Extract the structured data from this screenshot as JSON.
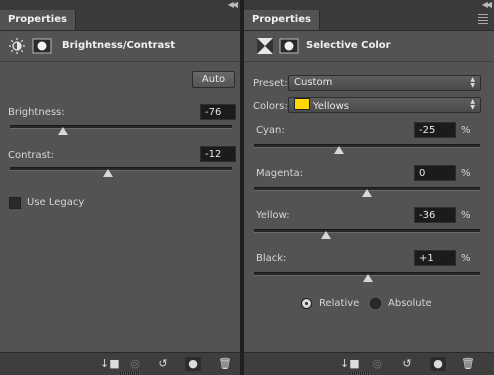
{
  "left": {
    "tab_label": "Properties",
    "title": "Brightness/Contrast",
    "auto_label": "Auto",
    "brightness": {
      "label": "Brightness:",
      "value": "-76",
      "slider": 0.24
    },
    "contrast": {
      "label": "Contrast:",
      "value": "-12",
      "slider": 0.44
    },
    "use_legacy_label": "Use Legacy",
    "use_legacy_checked": false
  },
  "right": {
    "tab_label": "Properties",
    "title": "Selective Color",
    "preset": {
      "label": "Preset:",
      "value": "Custom"
    },
    "colors": {
      "label": "Colors:",
      "value": "Yellows",
      "swatch": "#ffd800"
    },
    "cyan": {
      "label": "Cyan:",
      "value": "-25",
      "unit": "%",
      "slider": 0.375
    },
    "magenta": {
      "label": "Magenta:",
      "value": "0",
      "unit": "%",
      "slider": 0.5
    },
    "yellow": {
      "label": "Yellow:",
      "value": "-36",
      "unit": "%",
      "slider": 0.32
    },
    "black": {
      "label": "Black:",
      "value": "+1",
      "unit": "%",
      "slider": 0.505
    },
    "mode": {
      "relative_label": "Relative",
      "absolute_label": "Absolute",
      "selected": "relative"
    }
  },
  "footer_icons": [
    "clip-to-layer-icon",
    "visibility-cycle-icon",
    "reset-icon",
    "eye-icon",
    "trash-icon"
  ],
  "colors": {
    "panel_bg": "#535353",
    "tab_bg": "#3b3b3b",
    "field_bg": "#1b1b1b"
  }
}
